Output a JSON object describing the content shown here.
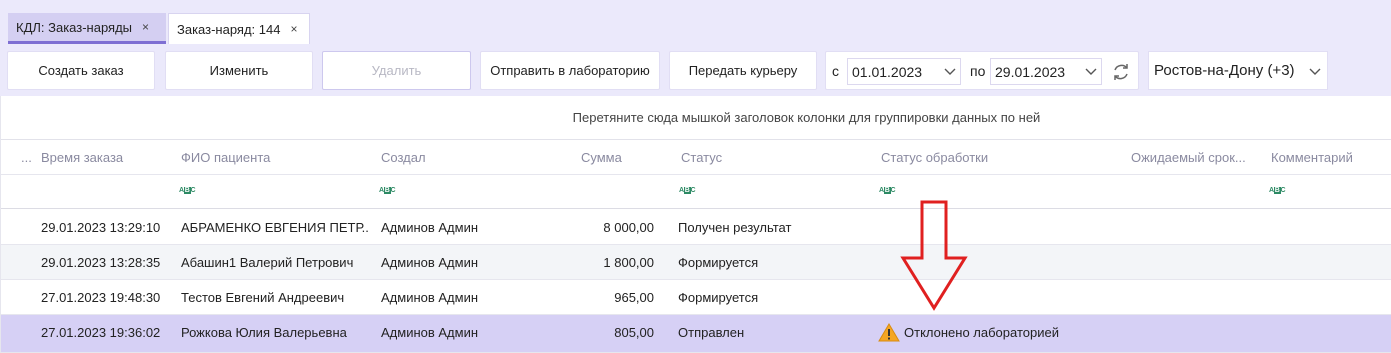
{
  "tabs": [
    {
      "label": "КДЛ: Заказ-наряды",
      "close": "×"
    },
    {
      "label": "Заказ-наряд: 144",
      "close": "×"
    }
  ],
  "toolbar": {
    "create": "Создать заказ",
    "edit": "Изменить",
    "delete": "Удалить",
    "send_lab": "Отправить в лабораторию",
    "courier": "Передать курьеру",
    "from_label": "с",
    "from_date": "01.01.2023",
    "to_label": "по",
    "to_date": "29.01.2023",
    "region": "Ростов-на-Дону (+3)"
  },
  "grid": {
    "group_hint": "Перетяните сюда мышкой заголовок колонки для группировки данных по ней",
    "columns": {
      "dots": "...",
      "time": "Время заказа",
      "fio": "ФИО пациента",
      "creator": "Создал",
      "sum": "Сумма",
      "status": "Статус",
      "proc": "Статус обработки",
      "expected": "Ожидаемый срок...",
      "comment": "Комментарий"
    },
    "rows": [
      {
        "time": "29.01.2023 13:29:10",
        "fio": "АБРАМЕНКО ЕВГЕНИЯ ПЕТР...",
        "creator": "Админов Админ",
        "sum": "8 000,00",
        "status": "Получен результат",
        "proc": ""
      },
      {
        "time": "29.01.2023 13:28:35",
        "fio": "Абашин1 Валерий Петрович",
        "creator": "Админов Админ",
        "sum": "1 800,00",
        "status": "Формируется",
        "proc": ""
      },
      {
        "time": "27.01.2023 19:48:30",
        "fio": "Тестов Евгений Андреевич",
        "creator": "Админов Админ",
        "sum": "965,00",
        "status": "Формируется",
        "proc": ""
      },
      {
        "time": "27.01.2023 19:36:02",
        "fio": "Рожкова Юлия Валерьевна",
        "creator": "Админов Админ",
        "sum": "805,00",
        "status": "Отправлен",
        "proc": "Отклонено лабораторией"
      }
    ]
  },
  "colors": {
    "accent": "#7e6fd3",
    "selected_row": "#d6d0f5",
    "arrow": "#e02020",
    "warning": "#f5a623"
  }
}
